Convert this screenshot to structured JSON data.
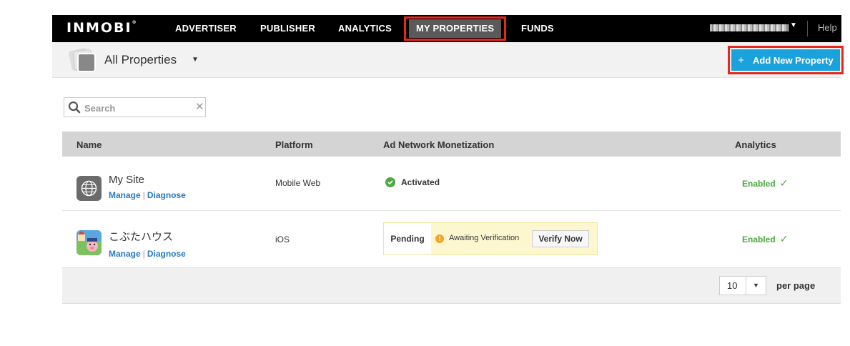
{
  "nav": {
    "logo": "INMOBI",
    "items": [
      "ADVERTISER",
      "PUBLISHER",
      "ANALYTICS",
      "MY PROPERTIES",
      "FUNDS"
    ],
    "active": "MY PROPERTIES",
    "help": "Help",
    "user_menu_icon": "caret-down-icon"
  },
  "subheader": {
    "title": "All Properties",
    "add_button": "Add New Property",
    "add_icon": "plus-icon"
  },
  "search": {
    "placeholder": "Search",
    "value": ""
  },
  "table": {
    "headers": {
      "name": "Name",
      "platform": "Platform",
      "monetization": "Ad Network Monetization",
      "analytics": "Analytics"
    },
    "rows": [
      {
        "name": "My Site",
        "icon": "globe-icon",
        "manage": "Manage",
        "diagnose": "Diagnose",
        "platform": "Mobile Web",
        "status": "Activated",
        "analytics": "Enabled"
      },
      {
        "name": "こぶたハウス",
        "icon": "app-icon",
        "manage": "Manage",
        "diagnose": "Diagnose",
        "platform": "iOS",
        "status": "Pending",
        "status_detail": "Awaiting Verification",
        "action": "Verify Now",
        "analytics": "Enabled"
      }
    ]
  },
  "pagination": {
    "per_page_value": "10",
    "per_page_label": "per page"
  },
  "colors": {
    "accent": "#1ba2dd",
    "highlight": "#e8261c",
    "success": "#4ea843",
    "link": "#2a7ac0"
  }
}
